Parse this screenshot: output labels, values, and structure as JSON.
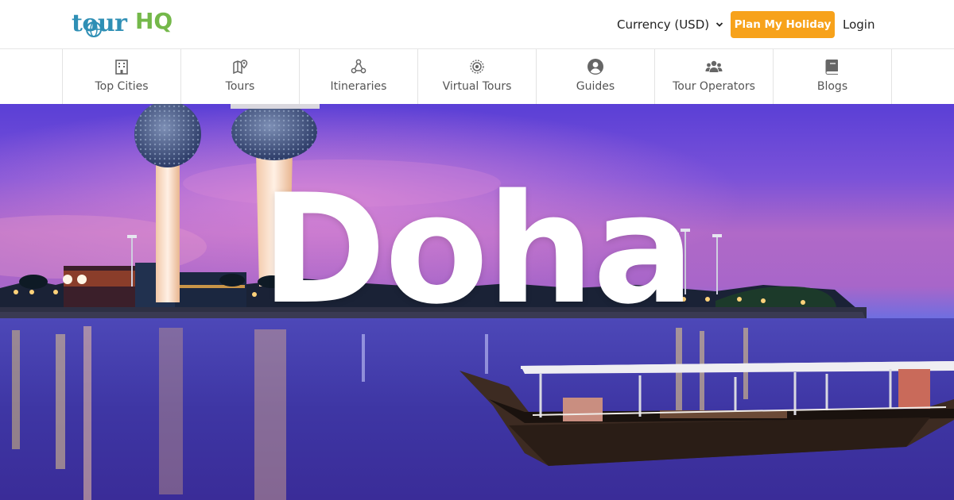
{
  "header": {
    "logo": {
      "part1": "tour",
      "part2": "HQ"
    },
    "currency_label": "Currency (USD)",
    "plan_button": "Plan My Holiday",
    "login": "Login"
  },
  "nav": {
    "items": [
      {
        "label": "Top Cities",
        "icon": "building-icon"
      },
      {
        "label": "Tours",
        "icon": "map-pin-icon"
      },
      {
        "label": "Itineraries",
        "icon": "route-icon"
      },
      {
        "label": "Virtual Tours",
        "icon": "target-icon"
      },
      {
        "label": "Guides",
        "icon": "user-circle-icon"
      },
      {
        "label": "Tour Operators",
        "icon": "users-icon"
      },
      {
        "label": "Blogs",
        "icon": "book-icon"
      }
    ]
  },
  "hero": {
    "title": "Doha"
  },
  "colors": {
    "accent": "#f7a21b",
    "logo_blue": "#2f8fb5",
    "logo_green": "#74b84a"
  }
}
